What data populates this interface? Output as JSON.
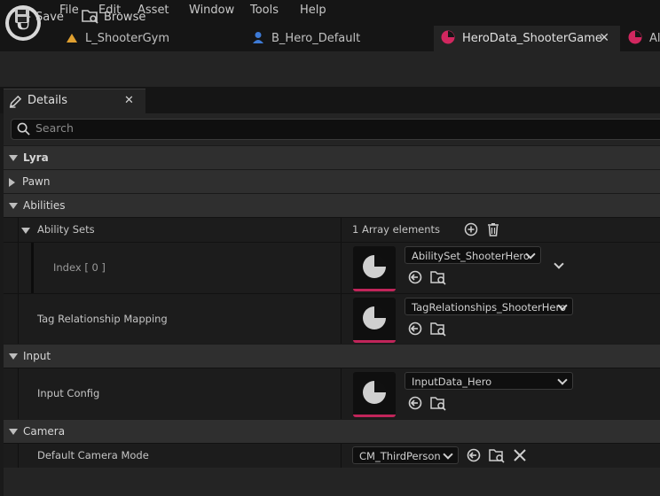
{
  "menu": [
    "File",
    "Edit",
    "Asset",
    "Window",
    "Tools",
    "Help"
  ],
  "tabs": [
    {
      "label": "L_ShooterGym",
      "icon": "level-icon"
    },
    {
      "label": "B_Hero_Default",
      "icon": "blueprint-actor-icon"
    },
    {
      "label": "HeroData_ShooterGame",
      "icon": "data-asset-icon",
      "active": true
    },
    {
      "label": "Al",
      "icon": "data-asset-icon"
    }
  ],
  "toolbar": {
    "save_label": "Save",
    "browse_label": "Browse"
  },
  "details": {
    "tab_label": "Details",
    "search_placeholder": "Search"
  },
  "sections": {
    "lyra": "Lyra",
    "pawn": "Pawn",
    "abilities": "Abilities",
    "input": "Input",
    "camera": "Camera"
  },
  "ability_sets": {
    "label": "Ability Sets",
    "array_count": "1 Array elements",
    "index_label": "Index [ 0 ]",
    "value": "AbilitySet_ShooterHero"
  },
  "tag_mapping": {
    "label": "Tag Relationship Mapping",
    "value": "TagRelationships_ShooterHero"
  },
  "input_config": {
    "label": "Input Config",
    "value": "InputData_Hero"
  },
  "camera_mode": {
    "label": "Default Camera Mode",
    "value": "CM_ThirdPerson"
  },
  "colors": {
    "accent": "#c1255a",
    "panel": "#242424",
    "row": "#1c1c1c"
  }
}
